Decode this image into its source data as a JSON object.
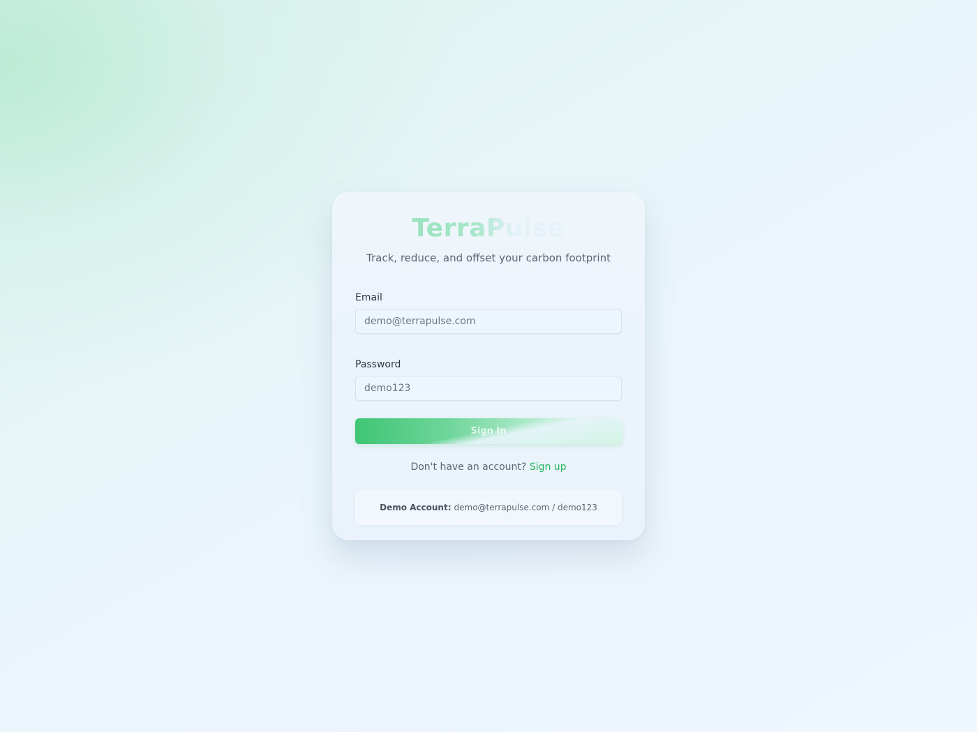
{
  "brand": {
    "name": "TerraPulse",
    "tagline": "Track, reduce, and offset your carbon footprint"
  },
  "form": {
    "email": {
      "label": "Email",
      "placeholder": "demo@terrapulse.com"
    },
    "password": {
      "label": "Password",
      "placeholder": "demo123"
    },
    "submit_label": "Sign In"
  },
  "signup": {
    "prompt": "Don't have an account?",
    "link_label": "Sign up"
  },
  "demo": {
    "label": "Demo Account:",
    "credentials": "demo@terrapulse.com / demo123"
  },
  "colors": {
    "accent": "#22b35e",
    "button_start": "#3fc575",
    "brand_tint": "#8fe0b6"
  }
}
